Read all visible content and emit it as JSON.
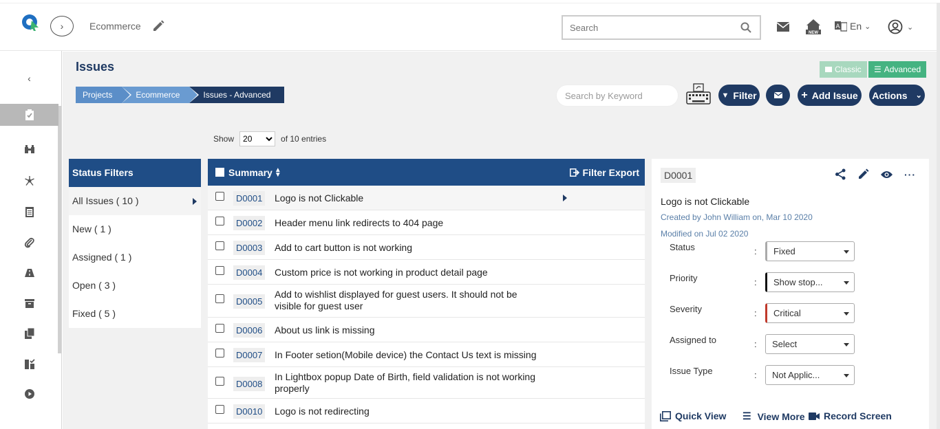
{
  "header": {
    "project_name": "Ecommerce",
    "search_placeholder": "Search",
    "lang": "En"
  },
  "sidebar": {
    "items": [
      "back-icon",
      "issues-icon",
      "binoculars-icon",
      "network-icon",
      "clipboard-icon",
      "attachment-icon",
      "road-icon",
      "archive-icon",
      "copy-icon",
      "checklist-icon",
      "play-icon"
    ]
  },
  "page": {
    "title": "Issues",
    "view_classic": "Classic",
    "view_advanced": "Advanced",
    "breadcrumbs": [
      "Projects",
      "Ecommerce",
      "Issues - Advanced"
    ],
    "keyword_placeholder": "Search by Keyword",
    "filter_label": "Filter",
    "add_issue_label": "Add Issue",
    "actions_label": "Actions",
    "show_label": "Show",
    "show_value": "20",
    "entries_label": "of 10 entries"
  },
  "status_filters": {
    "title": "Status Filters",
    "items": [
      "All Issues ( 10 )",
      "New ( 1 )",
      "Assigned ( 1 )",
      "Open ( 3 )",
      "Fixed ( 5 )"
    ]
  },
  "table": {
    "summary_header": "Summary",
    "filter_export": "Filter Export",
    "rows": [
      {
        "id": "D0001",
        "summary": "Logo is not Clickable"
      },
      {
        "id": "D0002",
        "summary": "Header menu link redirects to 404 page"
      },
      {
        "id": "D0003",
        "summary": "Add to cart button is not working"
      },
      {
        "id": "D0004",
        "summary": "Custom price is not working in product detail page"
      },
      {
        "id": "D0005",
        "summary": "Add to wishlist displayed for guest users. It should not be visible for guest user"
      },
      {
        "id": "D0006",
        "summary": "About us link is missing"
      },
      {
        "id": "D0007",
        "summary": "In Footer setion(Mobile device) the Contact Us text is missing"
      },
      {
        "id": "D0008",
        "summary": "In Lightbox popup Date of Birth, field validation is not working properly"
      },
      {
        "id": "D0010",
        "summary": "Logo is not redirecting"
      }
    ]
  },
  "detail": {
    "id": "D0001",
    "title": "Logo is not Clickable",
    "created": "Created by John William on, Mar 10 2020",
    "modified": "Modified on Jul 02 2020",
    "fields": [
      {
        "label": "Status",
        "value": "Fixed"
      },
      {
        "label": "Priority",
        "value": "Show stop..."
      },
      {
        "label": "Severity",
        "value": "Critical"
      },
      {
        "label": "Assigned to",
        "value": "Select"
      },
      {
        "label": "Issue Type",
        "value": "Not Applic..."
      }
    ],
    "quick_view": "Quick View",
    "view_more": "View More",
    "record_screen": "Record Screen"
  },
  "colors": {
    "primary": "#1f3a63",
    "table_header": "#1f4d86",
    "advanced_green": "#45b381",
    "classic_green": "#a8d8be",
    "severity_red": "#c0392b"
  }
}
